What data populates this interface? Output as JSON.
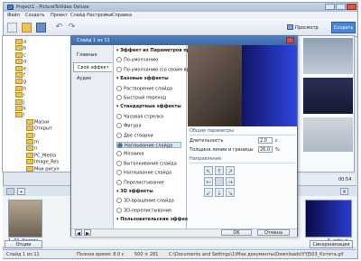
{
  "app": {
    "title": "Project1 - PictureToVideo Deluxe",
    "menu": [
      "Файл",
      "Создать",
      "Проект",
      "Слайд",
      "Настройки",
      "Справка"
    ]
  },
  "toolbar": {
    "preview_label": "Просмотр",
    "create_label": "Создать"
  },
  "tree": {
    "items": [
      "a",
      "b",
      "c",
      "d",
      "e",
      "f",
      "g",
      "h",
      "i",
      "j",
      "k",
      "l",
      "Маски",
      "Открыт",
      "l",
      "m",
      "n",
      "PC_Media",
      "Image_Res",
      "Мои рисун"
    ]
  },
  "dialog": {
    "title": "Слайд 1 из 11",
    "tabs": [
      "Главные",
      "Свой эффект",
      "Аудио"
    ],
    "effects": [
      {
        "label": "Эффект из Параметров про",
        "type": "head"
      },
      {
        "label": "По-умолчанию",
        "type": "radio"
      },
      {
        "label": "По-умолчанию (со своим вре",
        "type": "radio"
      },
      {
        "label": "Базовые эффекты",
        "type": "head"
      },
      {
        "label": "Растворение слайда",
        "type": "radio"
      },
      {
        "label": "Быстрый переход",
        "type": "radio"
      },
      {
        "label": "Стандартные эффекты",
        "type": "head"
      },
      {
        "label": "Часовая стрелка",
        "type": "radio"
      },
      {
        "label": "Фигура",
        "type": "radio"
      },
      {
        "label": "Две створки",
        "type": "radio"
      },
      {
        "label": "Наплывание слайда",
        "type": "selected"
      },
      {
        "label": "Мозаика",
        "type": "radio"
      },
      {
        "label": "Выталкивание слайда",
        "type": "radio"
      },
      {
        "label": "Наплывание слайда",
        "type": "radio"
      },
      {
        "label": "Перелистывание",
        "type": "radio"
      },
      {
        "label": "3D эффекты",
        "type": "head"
      },
      {
        "label": "3D-вращение слайда",
        "type": "radio"
      },
      {
        "label": "3D-перелистывание",
        "type": "radio"
      },
      {
        "label": "Пользовательские эффекты",
        "type": "head"
      }
    ],
    "params": {
      "section": "Общие параметры",
      "duration_label": "Длительность",
      "duration_value": "2.0",
      "duration_unit": "с",
      "border_label": "Толщина линии и границы",
      "border_value": "26.0",
      "border_unit": "%",
      "direction_label": "Направление"
    },
    "footer": {
      "ok": "OK",
      "cancel": "Отмена"
    }
  },
  "strip": {
    "slides": [
      "1. 01_Котята",
      "5. cats_p"
    ],
    "time": "00:54"
  },
  "bottom": {
    "btn1": "Опции проекта",
    "btn2": "Синхронизация"
  },
  "status": {
    "slide": "Слайд 1 из 11",
    "total": "Полное время: 8.0 с",
    "size": "500 × 281",
    "path": "C:\\Documents and Settings\\1\\Мои документы\\Downloads\\YYJ503_Котята.gif"
  }
}
